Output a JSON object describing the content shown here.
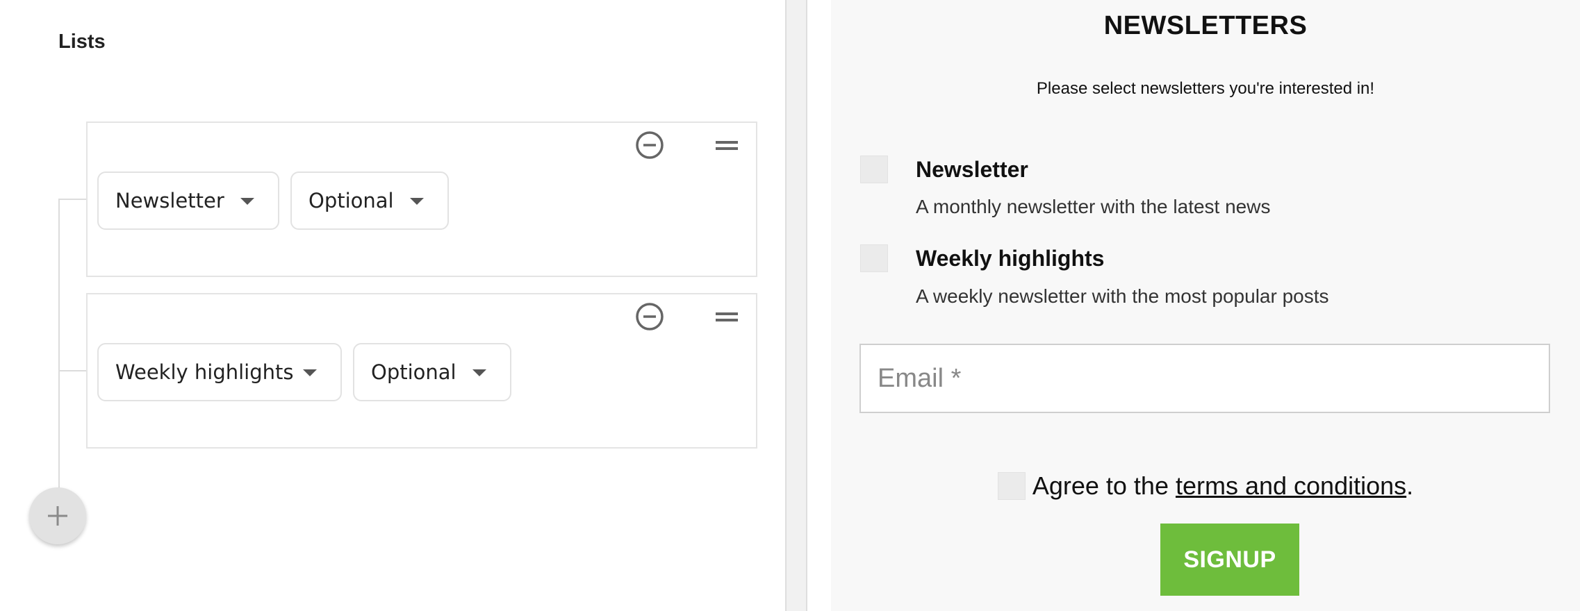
{
  "editor": {
    "heading": "Lists",
    "rows": [
      {
        "list_select": {
          "value": "Newsletter"
        },
        "requirement_select": {
          "value": "Optional"
        },
        "remove_icon": "minus-circle-icon",
        "drag_icon": "drag-handle-icon"
      },
      {
        "list_select": {
          "value": "Weekly highlights"
        },
        "requirement_select": {
          "value": "Optional"
        },
        "remove_icon": "minus-circle-icon",
        "drag_icon": "drag-handle-icon"
      }
    ],
    "add_button_icon": "plus-icon"
  },
  "preview": {
    "title": "NEWSLETTERS",
    "subtitle": "Please select newsletters you're interested in!",
    "options": [
      {
        "name": "Newsletter",
        "description": "A monthly newsletter with the latest news",
        "checked": false
      },
      {
        "name": "Weekly highlights",
        "description": "A weekly newsletter with the most popular posts",
        "checked": false
      }
    ],
    "email": {
      "placeholder": "Email *",
      "value": ""
    },
    "terms": {
      "prefix": "Agree to the ",
      "link_text": "terms and conditions",
      "suffix": ".",
      "checked": false
    },
    "signup_label": "SIGNUP"
  },
  "colors": {
    "signup_green": "#6ebd3c",
    "icon_gray": "#666666",
    "checkbox_gray": "#ebebeb",
    "preview_background": "#f8f8f8"
  }
}
